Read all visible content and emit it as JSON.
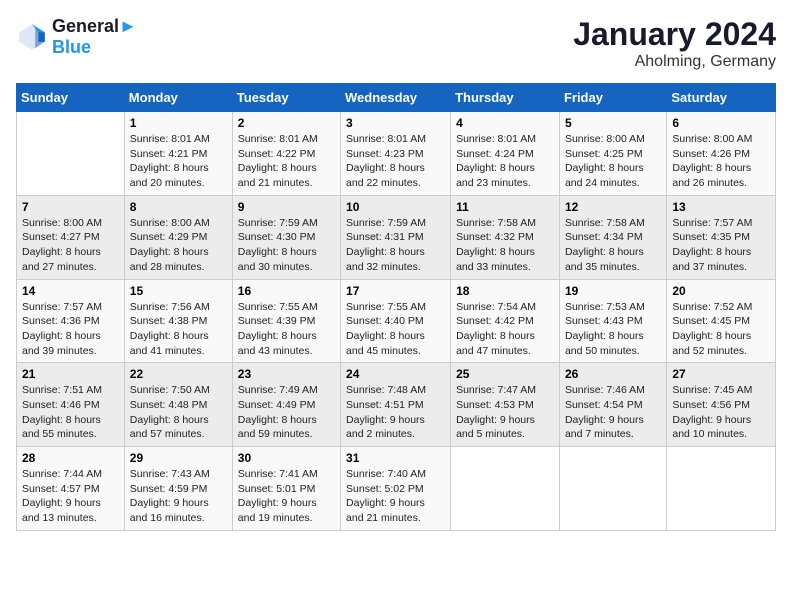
{
  "logo": {
    "line1": "General",
    "line2": "Blue"
  },
  "title": "January 2024",
  "subtitle": "Aholming, Germany",
  "days_header": [
    "Sunday",
    "Monday",
    "Tuesday",
    "Wednesday",
    "Thursday",
    "Friday",
    "Saturday"
  ],
  "weeks": [
    [
      {
        "day": "",
        "sunrise": "",
        "sunset": "",
        "daylight": ""
      },
      {
        "day": "1",
        "sunrise": "Sunrise: 8:01 AM",
        "sunset": "Sunset: 4:21 PM",
        "daylight": "Daylight: 8 hours and 20 minutes."
      },
      {
        "day": "2",
        "sunrise": "Sunrise: 8:01 AM",
        "sunset": "Sunset: 4:22 PM",
        "daylight": "Daylight: 8 hours and 21 minutes."
      },
      {
        "day": "3",
        "sunrise": "Sunrise: 8:01 AM",
        "sunset": "Sunset: 4:23 PM",
        "daylight": "Daylight: 8 hours and 22 minutes."
      },
      {
        "day": "4",
        "sunrise": "Sunrise: 8:01 AM",
        "sunset": "Sunset: 4:24 PM",
        "daylight": "Daylight: 8 hours and 23 minutes."
      },
      {
        "day": "5",
        "sunrise": "Sunrise: 8:00 AM",
        "sunset": "Sunset: 4:25 PM",
        "daylight": "Daylight: 8 hours and 24 minutes."
      },
      {
        "day": "6",
        "sunrise": "Sunrise: 8:00 AM",
        "sunset": "Sunset: 4:26 PM",
        "daylight": "Daylight: 8 hours and 26 minutes."
      }
    ],
    [
      {
        "day": "7",
        "sunrise": "Sunrise: 8:00 AM",
        "sunset": "Sunset: 4:27 PM",
        "daylight": "Daylight: 8 hours and 27 minutes."
      },
      {
        "day": "8",
        "sunrise": "Sunrise: 8:00 AM",
        "sunset": "Sunset: 4:29 PM",
        "daylight": "Daylight: 8 hours and 28 minutes."
      },
      {
        "day": "9",
        "sunrise": "Sunrise: 7:59 AM",
        "sunset": "Sunset: 4:30 PM",
        "daylight": "Daylight: 8 hours and 30 minutes."
      },
      {
        "day": "10",
        "sunrise": "Sunrise: 7:59 AM",
        "sunset": "Sunset: 4:31 PM",
        "daylight": "Daylight: 8 hours and 32 minutes."
      },
      {
        "day": "11",
        "sunrise": "Sunrise: 7:58 AM",
        "sunset": "Sunset: 4:32 PM",
        "daylight": "Daylight: 8 hours and 33 minutes."
      },
      {
        "day": "12",
        "sunrise": "Sunrise: 7:58 AM",
        "sunset": "Sunset: 4:34 PM",
        "daylight": "Daylight: 8 hours and 35 minutes."
      },
      {
        "day": "13",
        "sunrise": "Sunrise: 7:57 AM",
        "sunset": "Sunset: 4:35 PM",
        "daylight": "Daylight: 8 hours and 37 minutes."
      }
    ],
    [
      {
        "day": "14",
        "sunrise": "Sunrise: 7:57 AM",
        "sunset": "Sunset: 4:36 PM",
        "daylight": "Daylight: 8 hours and 39 minutes."
      },
      {
        "day": "15",
        "sunrise": "Sunrise: 7:56 AM",
        "sunset": "Sunset: 4:38 PM",
        "daylight": "Daylight: 8 hours and 41 minutes."
      },
      {
        "day": "16",
        "sunrise": "Sunrise: 7:55 AM",
        "sunset": "Sunset: 4:39 PM",
        "daylight": "Daylight: 8 hours and 43 minutes."
      },
      {
        "day": "17",
        "sunrise": "Sunrise: 7:55 AM",
        "sunset": "Sunset: 4:40 PM",
        "daylight": "Daylight: 8 hours and 45 minutes."
      },
      {
        "day": "18",
        "sunrise": "Sunrise: 7:54 AM",
        "sunset": "Sunset: 4:42 PM",
        "daylight": "Daylight: 8 hours and 47 minutes."
      },
      {
        "day": "19",
        "sunrise": "Sunrise: 7:53 AM",
        "sunset": "Sunset: 4:43 PM",
        "daylight": "Daylight: 8 hours and 50 minutes."
      },
      {
        "day": "20",
        "sunrise": "Sunrise: 7:52 AM",
        "sunset": "Sunset: 4:45 PM",
        "daylight": "Daylight: 8 hours and 52 minutes."
      }
    ],
    [
      {
        "day": "21",
        "sunrise": "Sunrise: 7:51 AM",
        "sunset": "Sunset: 4:46 PM",
        "daylight": "Daylight: 8 hours and 55 minutes."
      },
      {
        "day": "22",
        "sunrise": "Sunrise: 7:50 AM",
        "sunset": "Sunset: 4:48 PM",
        "daylight": "Daylight: 8 hours and 57 minutes."
      },
      {
        "day": "23",
        "sunrise": "Sunrise: 7:49 AM",
        "sunset": "Sunset: 4:49 PM",
        "daylight": "Daylight: 8 hours and 59 minutes."
      },
      {
        "day": "24",
        "sunrise": "Sunrise: 7:48 AM",
        "sunset": "Sunset: 4:51 PM",
        "daylight": "Daylight: 9 hours and 2 minutes."
      },
      {
        "day": "25",
        "sunrise": "Sunrise: 7:47 AM",
        "sunset": "Sunset: 4:53 PM",
        "daylight": "Daylight: 9 hours and 5 minutes."
      },
      {
        "day": "26",
        "sunrise": "Sunrise: 7:46 AM",
        "sunset": "Sunset: 4:54 PM",
        "daylight": "Daylight: 9 hours and 7 minutes."
      },
      {
        "day": "27",
        "sunrise": "Sunrise: 7:45 AM",
        "sunset": "Sunset: 4:56 PM",
        "daylight": "Daylight: 9 hours and 10 minutes."
      }
    ],
    [
      {
        "day": "28",
        "sunrise": "Sunrise: 7:44 AM",
        "sunset": "Sunset: 4:57 PM",
        "daylight": "Daylight: 9 hours and 13 minutes."
      },
      {
        "day": "29",
        "sunrise": "Sunrise: 7:43 AM",
        "sunset": "Sunset: 4:59 PM",
        "daylight": "Daylight: 9 hours and 16 minutes."
      },
      {
        "day": "30",
        "sunrise": "Sunrise: 7:41 AM",
        "sunset": "Sunset: 5:01 PM",
        "daylight": "Daylight: 9 hours and 19 minutes."
      },
      {
        "day": "31",
        "sunrise": "Sunrise: 7:40 AM",
        "sunset": "Sunset: 5:02 PM",
        "daylight": "Daylight: 9 hours and 21 minutes."
      },
      {
        "day": "",
        "sunrise": "",
        "sunset": "",
        "daylight": ""
      },
      {
        "day": "",
        "sunrise": "",
        "sunset": "",
        "daylight": ""
      },
      {
        "day": "",
        "sunrise": "",
        "sunset": "",
        "daylight": ""
      }
    ]
  ]
}
